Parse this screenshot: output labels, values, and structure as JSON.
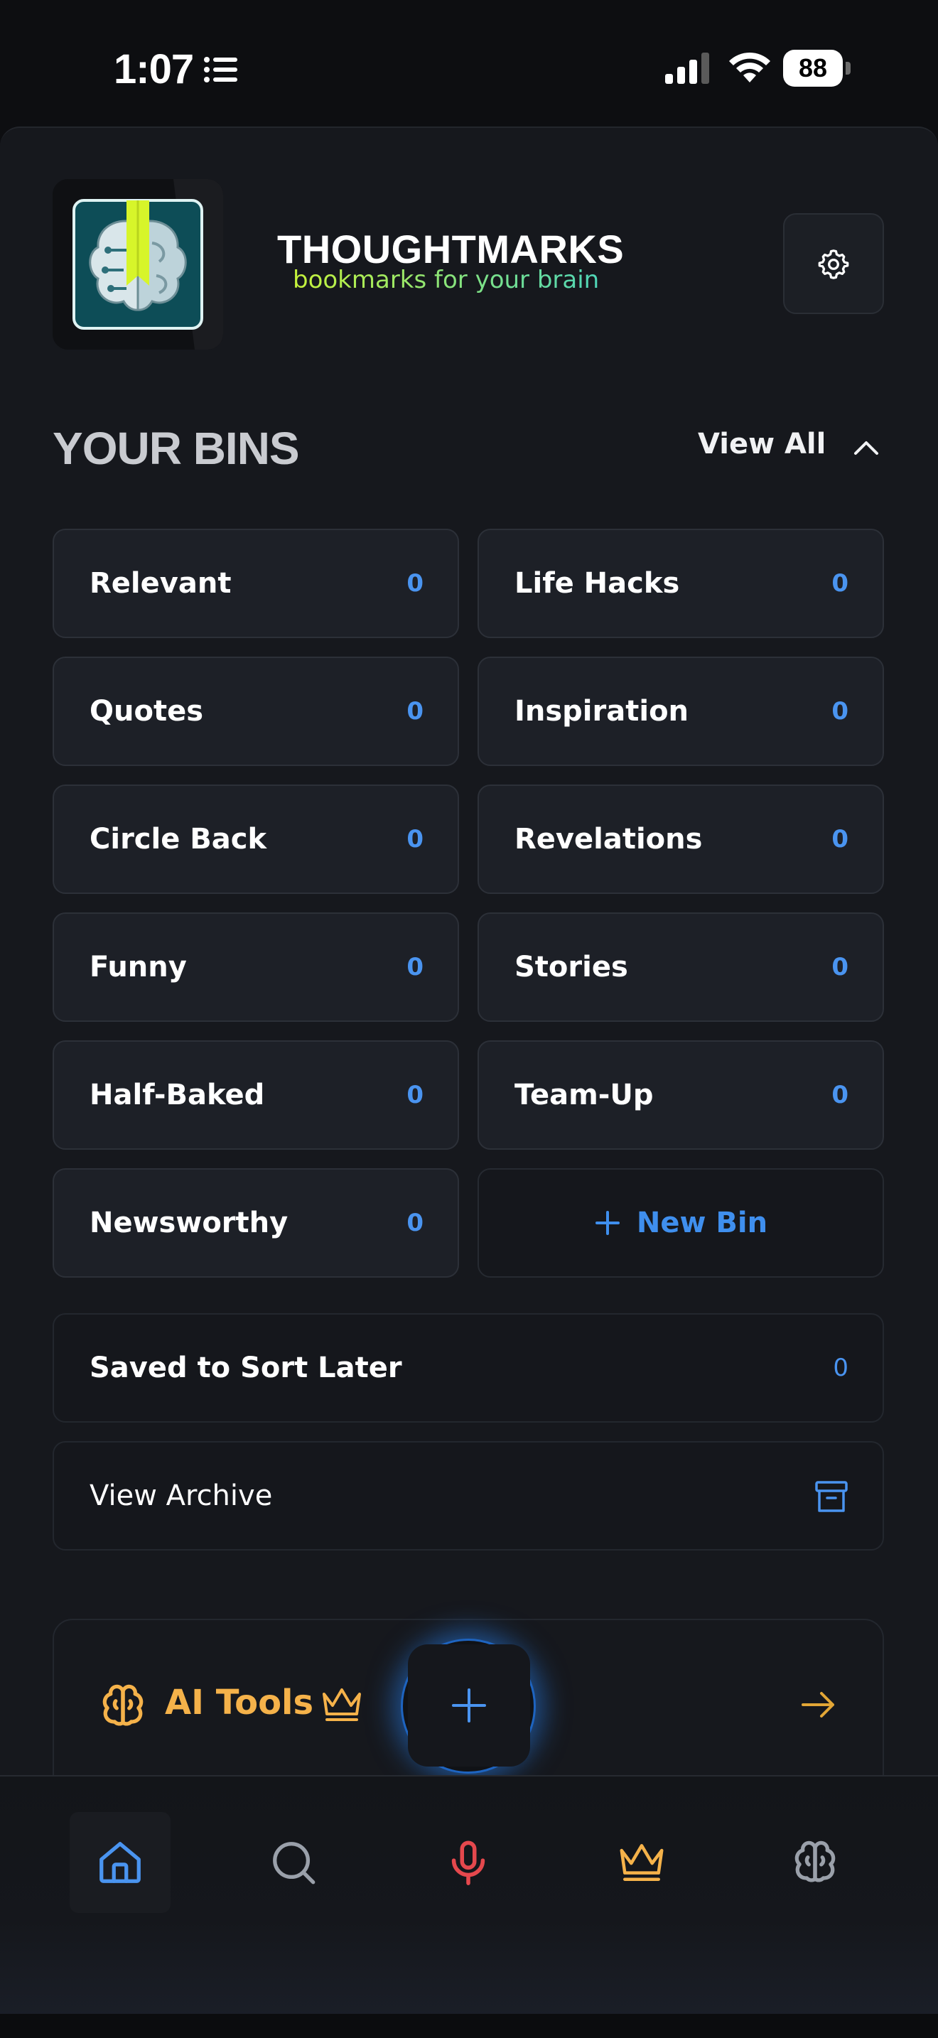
{
  "status_bar": {
    "time": "1:07",
    "battery": "88",
    "icons": [
      "list-icon",
      "cellular-signal-icon",
      "wifi-icon",
      "battery-icon"
    ]
  },
  "header": {
    "title": "THOUGHTMARKS",
    "tagline": "bookmarks for your brain",
    "logo_icon": "brain-bookmark-logo",
    "settings_icon": "gear-icon"
  },
  "bins_section": {
    "title": "YOUR BINS",
    "view_all_label": "View All",
    "bins": [
      {
        "label": "Relevant",
        "count": "0"
      },
      {
        "label": "Life Hacks",
        "count": "0"
      },
      {
        "label": "Quotes",
        "count": "0"
      },
      {
        "label": "Inspiration",
        "count": "0"
      },
      {
        "label": "Circle Back",
        "count": "0"
      },
      {
        "label": "Revelations",
        "count": "0"
      },
      {
        "label": "Funny",
        "count": "0"
      },
      {
        "label": "Stories",
        "count": "0"
      },
      {
        "label": "Half-Baked",
        "count": "0"
      },
      {
        "label": "Team-Up",
        "count": "0"
      },
      {
        "label": "Newsworthy",
        "count": "0"
      }
    ],
    "new_bin_label": "New Bin",
    "saved_to_sort_later": {
      "label": "Saved to Sort Later",
      "count": "0"
    },
    "view_archive_label": "View Archive"
  },
  "ai_tools": {
    "label": "AI Tools",
    "accent_color": "#f5b24a"
  },
  "tab_bar": {
    "items": [
      "home-icon",
      "search-icon",
      "microphone-icon",
      "crown-icon",
      "brain-icon"
    ],
    "active": "home-icon"
  },
  "colors": {
    "accent_blue": "#4a94f0",
    "mic_red": "#e5484d",
    "gold": "#f5b24a",
    "background": "#16181d"
  }
}
